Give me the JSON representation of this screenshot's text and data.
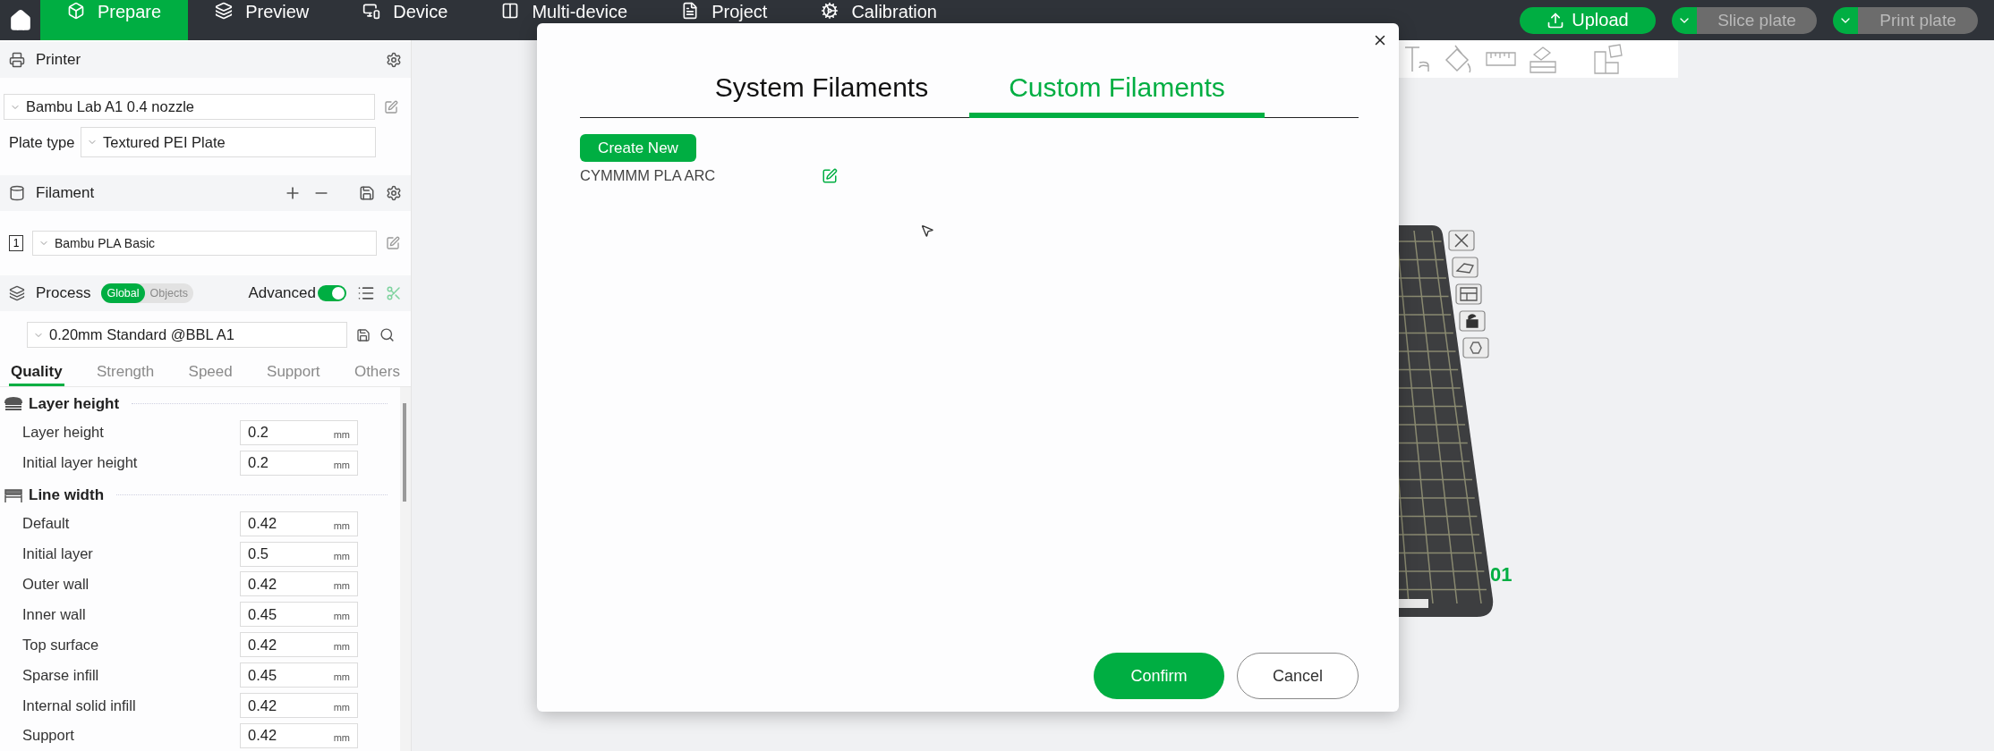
{
  "top_nav": {
    "tabs": [
      {
        "label": "Prepare",
        "selected": true
      },
      {
        "label": "Preview",
        "selected": false
      },
      {
        "label": "Device",
        "selected": false
      },
      {
        "label": "Multi-device",
        "selected": false
      },
      {
        "label": "Project",
        "selected": false
      },
      {
        "label": "Calibration",
        "selected": false
      }
    ]
  },
  "top_actions": {
    "upload": "Upload",
    "slice": "Slice plate",
    "print": "Print plate"
  },
  "sidebar": {
    "printer": {
      "title": "Printer",
      "preset": "Bambu Lab A1 0.4 nozzle",
      "plate_label": "Plate type",
      "plate_value": "Textured PEI Plate"
    },
    "filament": {
      "title": "Filament",
      "items": [
        {
          "index": "1",
          "name": "Bambu PLA Basic"
        }
      ]
    },
    "process": {
      "title": "Process",
      "scope": [
        {
          "label": "Global",
          "selected": true
        },
        {
          "label": "Objects",
          "selected": false
        }
      ],
      "advanced_label": "Advanced",
      "advanced_on": true,
      "preset": "0.20mm Standard @BBL A1"
    },
    "tabs": [
      {
        "label": "Quality",
        "selected": true
      },
      {
        "label": "Strength",
        "selected": false
      },
      {
        "label": "Speed",
        "selected": false
      },
      {
        "label": "Support",
        "selected": false
      },
      {
        "label": "Others",
        "selected": false
      }
    ],
    "groups": [
      {
        "title": "Layer height",
        "kind": "layers",
        "rows": [
          {
            "label": "Layer height",
            "value": "0.2",
            "unit": "mm"
          },
          {
            "label": "Initial layer height",
            "value": "0.2",
            "unit": "mm"
          }
        ]
      },
      {
        "title": "Line width",
        "kind": "width",
        "rows": [
          {
            "label": "Default",
            "value": "0.42",
            "unit": "mm"
          },
          {
            "label": "Initial layer",
            "value": "0.5",
            "unit": "mm"
          },
          {
            "label": "Outer wall",
            "value": "0.42",
            "unit": "mm"
          },
          {
            "label": "Inner wall",
            "value": "0.45",
            "unit": "mm"
          },
          {
            "label": "Top surface",
            "value": "0.42",
            "unit": "mm"
          },
          {
            "label": "Sparse infill",
            "value": "0.45",
            "unit": "mm"
          },
          {
            "label": "Internal solid infill",
            "value": "0.42",
            "unit": "mm"
          },
          {
            "label": "Support",
            "value": "0.42",
            "unit": "mm"
          }
        ]
      }
    ]
  },
  "canvas": {
    "plate_label": "01"
  },
  "dialog": {
    "tabs": [
      {
        "label": "System Filaments",
        "selected": false
      },
      {
        "label": "Custom Filaments",
        "selected": true
      }
    ],
    "create_button": "Create New",
    "filaments": [
      {
        "name": "CYMMMM PLA ARC"
      }
    ],
    "confirm": "Confirm",
    "cancel": "Cancel"
  }
}
